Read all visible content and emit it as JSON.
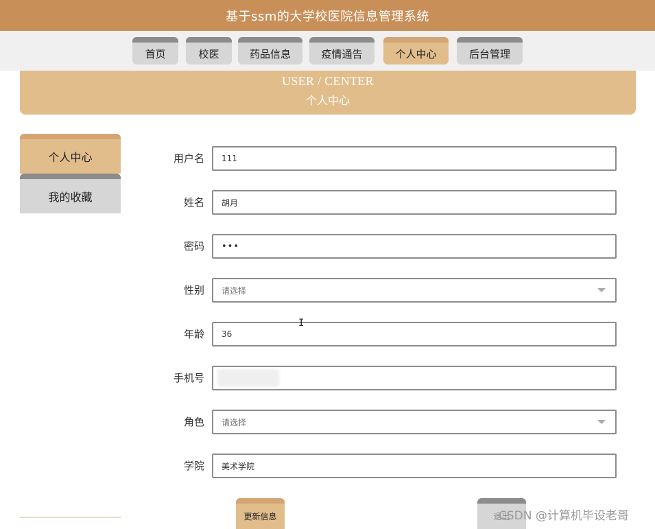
{
  "app_title": "基于ssm的大学校医院信息管理系统",
  "nav": {
    "tabs": [
      {
        "label": "首页",
        "active": false
      },
      {
        "label": "校医",
        "active": false
      },
      {
        "label": "药品信息",
        "active": false
      },
      {
        "label": "疫情通告",
        "active": false
      },
      {
        "label": "个人中心",
        "active": true
      },
      {
        "label": "后台管理",
        "active": false
      }
    ]
  },
  "banner": {
    "title_en": "USER / CENTER",
    "title_cn": "个人中心"
  },
  "side_menu": {
    "items": [
      {
        "label": "个人中心",
        "active": true
      },
      {
        "label": "我的收藏",
        "active": false
      }
    ]
  },
  "form": {
    "username": {
      "label": "用户名",
      "value": "111"
    },
    "name": {
      "label": "姓名",
      "value": "胡月"
    },
    "password": {
      "label": "密码",
      "value": "•••"
    },
    "gender": {
      "label": "性别",
      "placeholder": "请选择"
    },
    "age": {
      "label": "年龄",
      "value": "36"
    },
    "phone": {
      "label": "手机号",
      "value": ""
    },
    "role": {
      "label": "角色",
      "placeholder": "请选择"
    },
    "college": {
      "label": "学院",
      "value": "美术学院"
    }
  },
  "actions": {
    "update_label": "更新信息",
    "logout_label": "退出"
  },
  "watermark": "CSDN @计算机毕设老哥",
  "colors": {
    "brand": "#c98f58",
    "accent_light": "#e2bd8c",
    "tab_inactive": "#d6d6d6",
    "tab_stripe": "#8c8c8c"
  }
}
